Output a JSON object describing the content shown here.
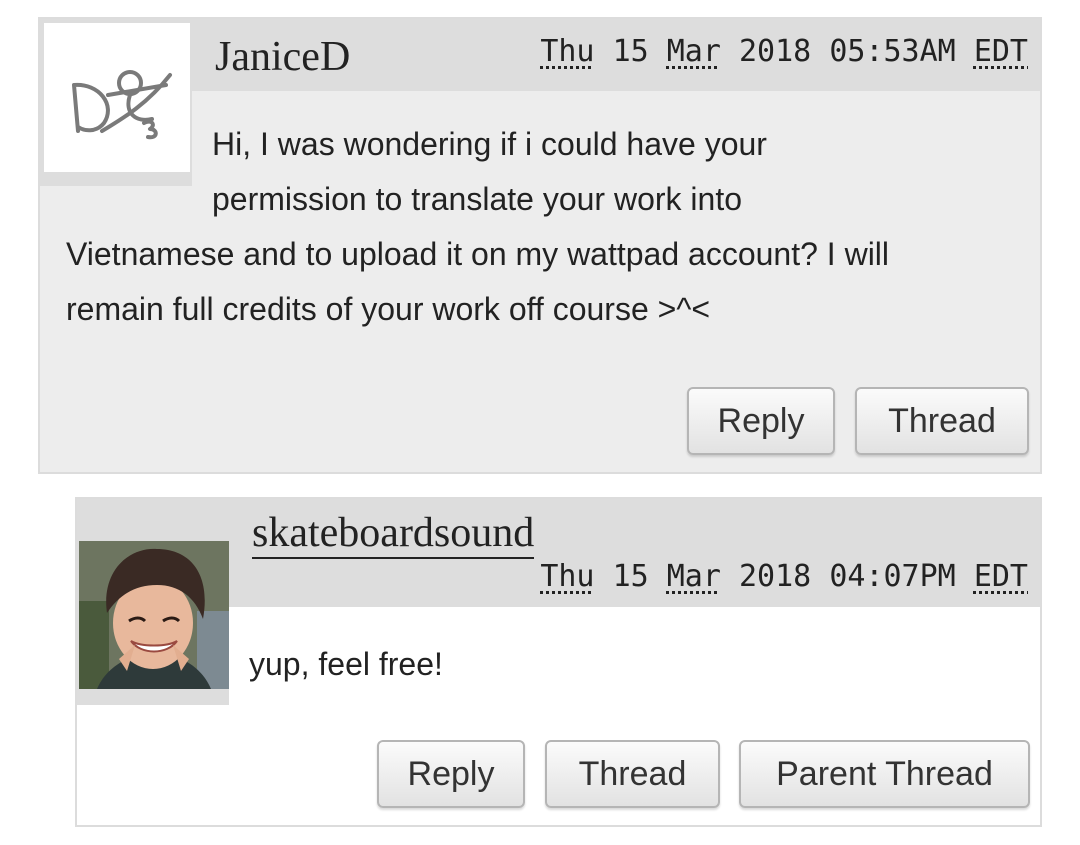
{
  "comments": [
    {
      "username": "JaniceD",
      "date": {
        "day": "Thu",
        "daynum": "15",
        "month": "Mar",
        "year": "2018",
        "time": "05:53AM",
        "tz": "EDT"
      },
      "body_lines": [
        "Hi, I was wondering if i could have your",
        "permission to translate your work into",
        "Vietnamese and to upload it on my wattpad account? I will",
        "remain full credits of your work off course >^<"
      ],
      "buttons": {
        "reply": "Reply",
        "thread": "Thread"
      },
      "avatar_icon": "default-user-scribble-icon"
    },
    {
      "username": "skateboardsound",
      "date": {
        "day": "Thu",
        "daynum": "15",
        "month": "Mar",
        "year": "2018",
        "time": "04:07PM",
        "tz": "EDT"
      },
      "body": "yup, feel free!",
      "buttons": {
        "reply": "Reply",
        "thread": "Thread",
        "parent_thread": "Parent Thread"
      },
      "avatar_icon": "user-photo"
    }
  ],
  "colors": {
    "page_background": "#ffffff",
    "comment1_background": "#ededed",
    "header_background": "#dddddd",
    "border": "#dcdcdc"
  }
}
